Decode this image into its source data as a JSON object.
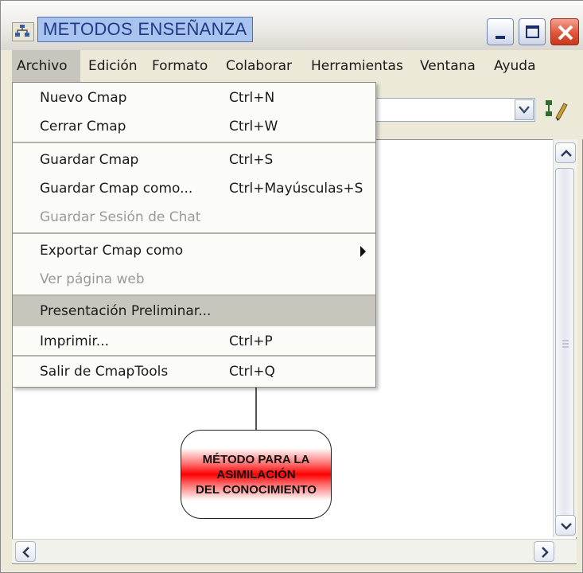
{
  "window": {
    "title": "METODOS ENSEÑANZA"
  },
  "title_buttons": {
    "minimize": "minimize-icon",
    "maximize": "maximize-icon",
    "close": "close-icon"
  },
  "menubar": {
    "items": [
      {
        "label": "Archivo",
        "active": true
      },
      {
        "label": "Edición"
      },
      {
        "label": "Formato"
      },
      {
        "label": "Colaborar"
      },
      {
        "label": "Herramientas"
      },
      {
        "label": "Ventana"
      },
      {
        "label": "Ayuda"
      }
    ]
  },
  "file_menu": {
    "items": [
      {
        "label": "Nuevo Cmap",
        "shortcut": "Ctrl+N",
        "enabled": true
      },
      {
        "label": "Cerrar Cmap",
        "shortcut": "Ctrl+W",
        "enabled": true
      },
      {
        "label": "Guardar Cmap",
        "shortcut": "Ctrl+S",
        "enabled": true
      },
      {
        "label": "Guardar Cmap como...",
        "shortcut": "Ctrl+Mayúsculas+S",
        "enabled": true
      },
      {
        "label": "Guardar Sesión de Chat",
        "shortcut": "",
        "enabled": false
      },
      {
        "label": "Exportar Cmap como",
        "shortcut": "",
        "enabled": true,
        "submenu": true
      },
      {
        "label": "Ver página web",
        "shortcut": "",
        "enabled": false
      },
      {
        "label": "Presentación Preliminar...",
        "shortcut": "",
        "enabled": true,
        "highlighted": true
      },
      {
        "label": "Imprimir...",
        "shortcut": "Ctrl+P",
        "enabled": true
      },
      {
        "label": "Salir de CmapTools",
        "shortcut": "Ctrl+Q",
        "enabled": true
      }
    ]
  },
  "concept_node": {
    "text": "MÉTODO PARA LA\nASIMILACIÓN\nDEL CONOCIMIENTO"
  },
  "colors": {
    "title_highlight": "#a8c3ee",
    "close_button": "#e0553a",
    "menu_highlight": "#c7c5bc",
    "concept_fill": "#ff0000"
  }
}
